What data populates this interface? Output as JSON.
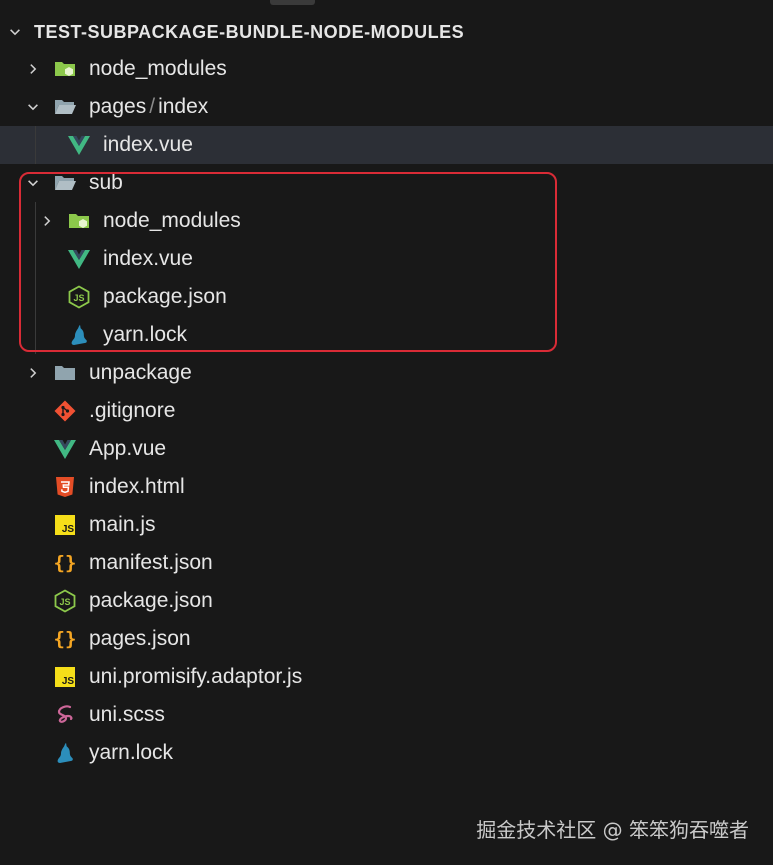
{
  "explorer": {
    "title": "TEST-SUBPACKAGE-BUNDLE-NODE-MODULES",
    "items": [
      {
        "label": "node_modules",
        "icon": "node-folder-icon",
        "expanded": false,
        "depth": 1
      },
      {
        "label": "pages",
        "sep": "/",
        "label2": "index",
        "icon": "folder-open-icon",
        "expanded": true,
        "depth": 1
      },
      {
        "label": "index.vue",
        "icon": "vue-icon",
        "depth": 2,
        "selected": true
      },
      {
        "label": "sub",
        "icon": "folder-open-icon",
        "expanded": true,
        "depth": 1
      },
      {
        "label": "node_modules",
        "icon": "node-folder-icon",
        "expanded": false,
        "depth": 2
      },
      {
        "label": "index.vue",
        "icon": "vue-icon",
        "depth": 2
      },
      {
        "label": "package.json",
        "icon": "nodejs-icon",
        "depth": 2
      },
      {
        "label": "yarn.lock",
        "icon": "yarn-icon",
        "depth": 2
      },
      {
        "label": "unpackage",
        "icon": "folder-icon",
        "expanded": false,
        "depth": 1
      },
      {
        "label": ".gitignore",
        "icon": "git-icon",
        "depth": 1
      },
      {
        "label": "App.vue",
        "icon": "vue-icon",
        "depth": 1
      },
      {
        "label": "index.html",
        "icon": "html5-icon",
        "depth": 1
      },
      {
        "label": "main.js",
        "icon": "js-icon",
        "depth": 1
      },
      {
        "label": "manifest.json",
        "icon": "json-braces-icon",
        "depth": 1
      },
      {
        "label": "package.json",
        "icon": "nodejs-icon",
        "depth": 1
      },
      {
        "label": "pages.json",
        "icon": "json-braces-icon",
        "depth": 1
      },
      {
        "label": "uni.promisify.adaptor.js",
        "icon": "js-icon",
        "depth": 1
      },
      {
        "label": "uni.scss",
        "icon": "sass-icon",
        "depth": 1
      },
      {
        "label": "yarn.lock",
        "icon": "yarn-icon",
        "depth": 1
      }
    ]
  },
  "watermark": "掘金技术社区 @ 笨笨狗吞噬者",
  "colors": {
    "background": "#181818",
    "selected_row": "#2c2f36",
    "highlight_border": "#d92b36",
    "vue_green": "#41b883",
    "node_green": "#8cc84b",
    "folder_gray": "#90a4ae",
    "html_orange": "#e44d26",
    "js_yellow": "#f5de19",
    "json_orange": "#f5a623",
    "git_red": "#f05133",
    "sass_pink": "#cd6799",
    "yarn_blue": "#2c8ebb"
  }
}
